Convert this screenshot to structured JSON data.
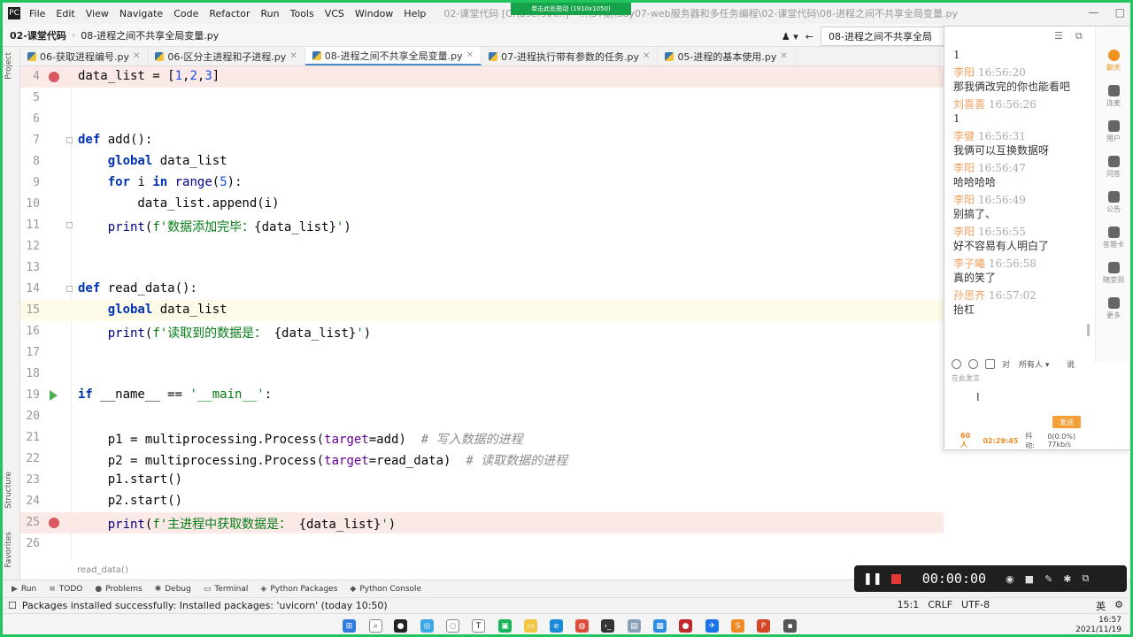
{
  "menubar": {
    "items": [
      "File",
      "Edit",
      "View",
      "Navigate",
      "Code",
      "Refactor",
      "Run",
      "Tools",
      "VCS",
      "Window",
      "Help"
    ],
    "window_title": "02-课堂代码 [C:\\Users\\A...] - ...\\57期\\day07-web服务器和多任务编程\\02-课堂代码\\08-进程之间不共享全局变量.py",
    "drag_banner": "单击此处拖动 (1910x1050)"
  },
  "navbar": {
    "project": "02-课堂代码",
    "file": "08-进程之间不共享全局变量.py",
    "run_config": "08-进程之间不共享全局"
  },
  "tabs": [
    {
      "label": "06-获取进程编号.py",
      "active": false
    },
    {
      "label": "06-区分主进程和子进程.py",
      "active": false
    },
    {
      "label": "08-进程之间不共享全局变量.py",
      "active": true
    },
    {
      "label": "07-进程执行带有参数的任务.py",
      "active": false
    },
    {
      "label": "05-进程的基本使用.py",
      "active": false
    }
  ],
  "side_labels": {
    "project": "Project",
    "structure": "Structure",
    "favorites": "Favorites"
  },
  "editor": {
    "breadcrumb": "read_data()",
    "lines": [
      {
        "n": "4",
        "marker": "breakpoint",
        "text": "data_list = [1,2,3]"
      },
      {
        "n": "5",
        "marker": "",
        "text": ""
      },
      {
        "n": "6",
        "marker": "",
        "text": ""
      },
      {
        "n": "7",
        "marker": "fold",
        "text": "def add():"
      },
      {
        "n": "8",
        "marker": "",
        "text": "    global data_list"
      },
      {
        "n": "9",
        "marker": "",
        "text": "    for i in range(5):"
      },
      {
        "n": "10",
        "marker": "",
        "text": "        data_list.append(i)"
      },
      {
        "n": "11",
        "marker": "fold",
        "text": "    print(f'数据添加完毕：{data_list}')"
      },
      {
        "n": "12",
        "marker": "",
        "text": ""
      },
      {
        "n": "13",
        "marker": "",
        "text": ""
      },
      {
        "n": "14",
        "marker": "fold",
        "text": "def read_data():"
      },
      {
        "n": "15",
        "marker": "",
        "text": "    global data_list"
      },
      {
        "n": "16",
        "marker": "",
        "text": "    print(f'读取到的数据是： {data_list}')"
      },
      {
        "n": "17",
        "marker": "",
        "text": ""
      },
      {
        "n": "18",
        "marker": "",
        "text": ""
      },
      {
        "n": "19",
        "marker": "run",
        "text": "if __name__ == '__main__':"
      },
      {
        "n": "20",
        "marker": "",
        "text": ""
      },
      {
        "n": "21",
        "marker": "",
        "text": "    p1 = multiprocessing.Process(target=add)  # 写入数据的进程"
      },
      {
        "n": "22",
        "marker": "",
        "text": "    p2 = multiprocessing.Process(target=read_data)  # 读取数据的进程"
      },
      {
        "n": "23",
        "marker": "",
        "text": "    p1.start()"
      },
      {
        "n": "24",
        "marker": "",
        "text": "    p2.start()"
      },
      {
        "n": "25",
        "marker": "breakpoint",
        "text": "    print(f'主进程中获取数据是： {data_list}')"
      },
      {
        "n": "26",
        "marker": "",
        "text": ""
      }
    ]
  },
  "toolwindows": [
    "Run",
    "TODO",
    "Problems",
    "Debug",
    "Terminal",
    "Python Packages",
    "Python Console"
  ],
  "statusbar": {
    "message": "Packages installed successfully: Installed packages: 'uvicorn' (today 10:50)",
    "position": "15:1",
    "line_sep": "CRLF",
    "encoding": "UTF-8"
  },
  "tray": {
    "ime": "英",
    "time": "16:57",
    "date": "2021/11/19"
  },
  "chat": {
    "first_line": "1",
    "messages": [
      {
        "name": "李阳",
        "time": "16:56:20",
        "text": "那我俩改完的你也能看吧"
      },
      {
        "name": "刘喜喜",
        "time": "16:56:26",
        "text": "1"
      },
      {
        "name": "李健",
        "time": "16:56:31",
        "text": "我俩可以互换数据呀"
      },
      {
        "name": "李阳",
        "time": "16:56:47",
        "text": "哈哈哈哈"
      },
      {
        "name": "李阳",
        "time": "16:56:49",
        "text": "别搞了、"
      },
      {
        "name": "李阳",
        "time": "16:56:55",
        "text": "好不容易有人明白了"
      },
      {
        "name": "李子曦",
        "time": "16:56:58",
        "text": "真的笑了"
      },
      {
        "name": "孙思齐",
        "time": "16:57:02",
        "text": "抬杠"
      }
    ],
    "side": [
      "聊天",
      "连麦",
      "用户",
      "问答",
      "公告",
      "答题卡",
      "随堂测",
      "更多"
    ],
    "to_label": "对",
    "to_select": "所有人",
    "say_label": "说",
    "input_placeholder": "在此发言",
    "send_label": "发送",
    "footer": {
      "count": "60人",
      "duration": "02:29:45",
      "jitter_label": "抖动:",
      "net": "0(0.0%) 77kb/s"
    }
  },
  "recorder": {
    "timer": "00:00:00"
  },
  "colors": {
    "accent": "#4a88c7",
    "breakpoint": "#db5860",
    "recording_border": "#22c55e",
    "chat_accent": "#f09020"
  }
}
